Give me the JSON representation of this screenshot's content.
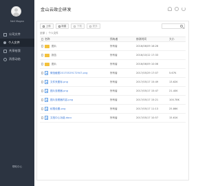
{
  "sidebar": {
    "username": "Neil Mogan",
    "items": [
      {
        "label": "公司文件",
        "icon": "building-icon",
        "active": false
      },
      {
        "label": "个人文件",
        "icon": "user-icon",
        "active": true
      },
      {
        "label": "共享给我",
        "icon": "share-icon",
        "active": false
      },
      {
        "label": "消息动态",
        "icon": "clock-icon",
        "active": false
      }
    ],
    "bottom_label": "帮助中心"
  },
  "header": {
    "title": "金山云政企研发",
    "icons": [
      "bell-icon",
      "gear-icon",
      "power-icon"
    ]
  },
  "toolbar": {
    "upload_label": "上传",
    "new_label": "新建",
    "download_label": "下载",
    "more_label": "更多"
  },
  "breadcrumb": [
    "全部",
    "个人文件"
  ],
  "table": {
    "headers": {
      "name": "名称",
      "owner": "所有者",
      "time": "修改时间",
      "size": "大小"
    },
    "rows": [
      {
        "type": "folder",
        "name": "图片",
        "owner": "所有者",
        "time": "2016/06/09 16:26",
        "size": ""
      },
      {
        "type": "folder",
        "name": "报告",
        "owner": "所有者",
        "time": "2016/10/12 17:33",
        "size": ""
      },
      {
        "type": "folder",
        "name": "图片",
        "owner": "所有者",
        "time": "2016/06/09 10:06",
        "size": ""
      },
      {
        "type": "image",
        "name": "微信截图20170529172947.png",
        "owner": "所有者",
        "time": "2017/05/29 17:07",
        "size": "5.67K"
      },
      {
        "type": "image",
        "name": "文件夹图标.png",
        "owner": "所有者",
        "time": "2017/05/17 15:49",
        "size": "13.62K"
      },
      {
        "type": "image",
        "name": "图片查看器.png",
        "owner": "所有者",
        "time": "2017/05/17 15:47",
        "size": "21.40K"
      },
      {
        "type": "image",
        "name": "图片查看器内容.png",
        "owner": "所有者",
        "time": "2017/05/17 15:21",
        "size": "100.78K"
      },
      {
        "type": "image",
        "name": "权限设置.png",
        "owner": "所有者",
        "time": "2017/05/17 11:13",
        "size": "25.86K"
      },
      {
        "type": "image",
        "name": "文档中心功能.docx",
        "owner": "所有者",
        "time": "2017/05/17 10:57",
        "size": "15.61K"
      }
    ]
  },
  "colors": {
    "sidebar_bg": "#2c3441",
    "sidebar_active_bg": "#1f2630",
    "folder": "#f3c13c",
    "file_link": "#3d7ad8"
  }
}
